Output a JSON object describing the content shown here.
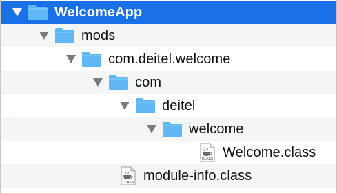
{
  "colors": {
    "selection": "#1a70e6",
    "folder": "#5fb8f5",
    "alt_row": "#f4f5f5"
  },
  "tree": {
    "items": [
      {
        "label": "WelcomeApp",
        "type": "folder",
        "expanded": true,
        "selected": true,
        "icon": "folder-icon"
      },
      {
        "label": "mods",
        "type": "folder",
        "expanded": true,
        "icon": "folder-icon"
      },
      {
        "label": "com.deitel.welcome",
        "type": "folder",
        "expanded": true,
        "icon": "folder-icon"
      },
      {
        "label": "com",
        "type": "folder",
        "expanded": true,
        "icon": "folder-icon"
      },
      {
        "label": "deitel",
        "type": "folder",
        "expanded": true,
        "icon": "folder-icon"
      },
      {
        "label": "welcome",
        "type": "folder",
        "expanded": true,
        "icon": "folder-icon"
      },
      {
        "label": "Welcome.class",
        "type": "file",
        "icon": "java-class-file-icon",
        "icon_text": "CLASS"
      },
      {
        "label": "module-info.class",
        "type": "file",
        "icon": "java-class-file-icon",
        "icon_text": "CLASS"
      }
    ]
  }
}
